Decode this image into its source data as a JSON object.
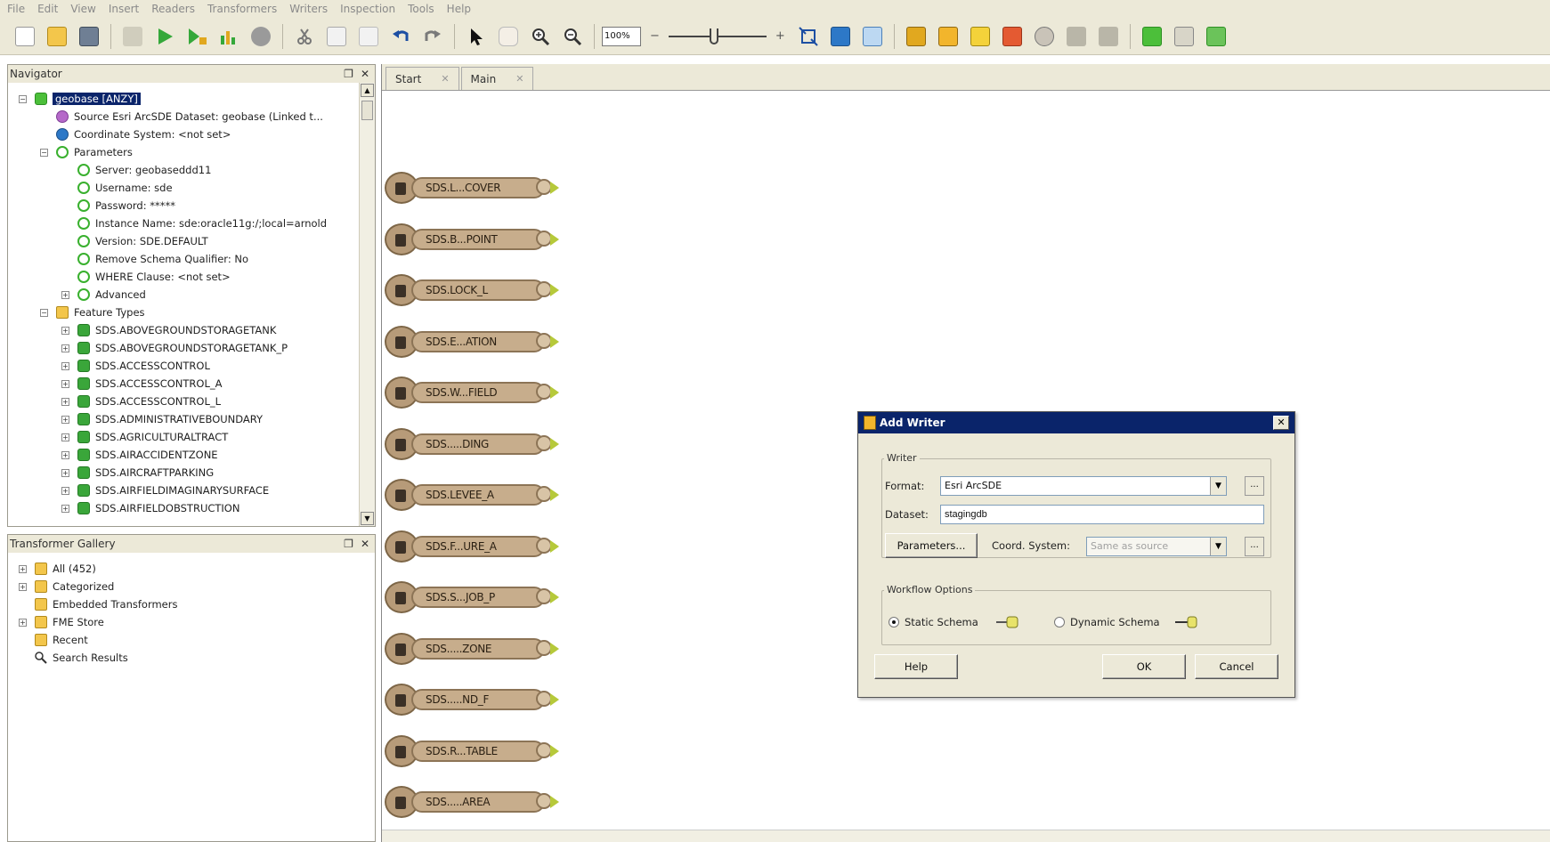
{
  "menu": [
    "File",
    "Edit",
    "View",
    "Insert",
    "Readers",
    "Transformers",
    "Writers",
    "Inspection",
    "Tools",
    "Help"
  ],
  "toolbar": {
    "zoom_value": "100%",
    "zoom_minus": "−",
    "zoom_plus": "+"
  },
  "navigator": {
    "title": "Navigator",
    "float_glyph": "❐",
    "close_glyph": "✕",
    "items": [
      {
        "text": "geobase [ANZY]",
        "level": 0,
        "icon": "database-icon",
        "expander": "−",
        "selected": true
      },
      {
        "text": "Source Esri ArcSDE Dataset: geobase (Linked t...",
        "level": 1,
        "icon": "source-icon"
      },
      {
        "text": "Coordinate System: <not set>",
        "level": 1,
        "icon": "globe-icon"
      },
      {
        "text": "Parameters",
        "level": 1,
        "icon": "parameters-icon",
        "expander": "−"
      },
      {
        "text": "Server: geobaseddd11",
        "level": 2,
        "icon": "parameter-icon"
      },
      {
        "text": "Username: sde",
        "level": 2,
        "icon": "parameter-icon"
      },
      {
        "text": "Password: *****",
        "level": 2,
        "icon": "parameter-icon"
      },
      {
        "text": "Instance Name: sde:oracle11g:/;local=arnold",
        "level": 2,
        "icon": "parameter-icon"
      },
      {
        "text": "Version: SDE.DEFAULT",
        "level": 2,
        "icon": "parameter-icon"
      },
      {
        "text": "Remove Schema Qualifier: No",
        "level": 2,
        "icon": "parameter-icon"
      },
      {
        "text": "WHERE Clause: <not set>",
        "level": 2,
        "icon": "parameter-icon"
      },
      {
        "text": "Advanced",
        "level": 2,
        "icon": "parameter-icon",
        "expander": "+"
      },
      {
        "text": "Feature Types",
        "level": 1,
        "icon": "feature-types-icon",
        "expander": "−"
      },
      {
        "text": "SDS.ABOVEGROUNDSTORAGETANK",
        "level": 2,
        "icon": "feature-type-icon",
        "expander": "+"
      },
      {
        "text": "SDS.ABOVEGROUNDSTORAGETANK_P",
        "level": 2,
        "icon": "feature-type-icon",
        "expander": "+"
      },
      {
        "text": "SDS.ACCESSCONTROL",
        "level": 2,
        "icon": "feature-type-icon",
        "expander": "+"
      },
      {
        "text": "SDS.ACCESSCONTROL_A",
        "level": 2,
        "icon": "feature-type-icon",
        "expander": "+"
      },
      {
        "text": "SDS.ACCESSCONTROL_L",
        "level": 2,
        "icon": "feature-type-icon",
        "expander": "+"
      },
      {
        "text": "SDS.ADMINISTRATIVEBOUNDARY",
        "level": 2,
        "icon": "feature-type-icon",
        "expander": "+"
      },
      {
        "text": "SDS.AGRICULTURALTRACT",
        "level": 2,
        "icon": "feature-type-icon",
        "expander": "+"
      },
      {
        "text": "SDS.AIRACCIDENTZONE",
        "level": 2,
        "icon": "feature-type-icon",
        "expander": "+"
      },
      {
        "text": "SDS.AIRCRAFTPARKING",
        "level": 2,
        "icon": "feature-type-icon",
        "expander": "+"
      },
      {
        "text": "SDS.AIRFIELDIMAGINARYSURFACE",
        "level": 2,
        "icon": "feature-type-icon",
        "expander": "+"
      },
      {
        "text": "SDS.AIRFIELDOBSTRUCTION",
        "level": 2,
        "icon": "feature-type-icon",
        "expander": "+"
      }
    ]
  },
  "gallery": {
    "title": "Transformer Gallery",
    "float_glyph": "❐",
    "close_glyph": "✕",
    "items": [
      {
        "text": "All (452)",
        "icon": "folder-icon",
        "expander": "+"
      },
      {
        "text": "Categorized",
        "icon": "folder-icon",
        "expander": "+"
      },
      {
        "text": "Embedded Transformers",
        "icon": "folder-icon"
      },
      {
        "text": "FME Store",
        "icon": "folder-icon",
        "expander": "+"
      },
      {
        "text": "Recent",
        "icon": "folder-icon"
      },
      {
        "text": "Search Results",
        "icon": "search-icon"
      }
    ]
  },
  "canvas": {
    "tabs": [
      {
        "label": "Start",
        "close": "✕"
      },
      {
        "label": "Main",
        "close": "✕"
      }
    ],
    "nodes": [
      "SDS.L...COVER",
      "SDS.B...POINT",
      "SDS.LOCK_L",
      "SDS.E...ATION",
      "SDS.W...FIELD",
      "SDS.....DING",
      "SDS.LEVEE_A",
      "SDS.F...URE_A",
      "SDS.S...JOB_P",
      "SDS.....ZONE",
      "SDS.....ND_F",
      "SDS.R...TABLE",
      "SDS.....AREA"
    ]
  },
  "dialog": {
    "title": "Add Writer",
    "close": "✕",
    "writer_group": "Writer",
    "format_label": "Format:",
    "format_value": "Esri ArcSDE",
    "dataset_label": "Dataset:",
    "dataset_value": "stagingdb",
    "parameters_button": "Parameters...",
    "coord_label": "Coord. System:",
    "coord_placeholder": "Same as source",
    "ellipsis": "...",
    "workflow_group": "Workflow Options",
    "static_schema": "Static Schema",
    "dynamic_schema": "Dynamic Schema",
    "help_button": "Help",
    "ok_button": "OK",
    "cancel_button": "Cancel"
  },
  "colors": {
    "title_blue": "#0a246a",
    "chrome": "#ece9d8",
    "node_fill": "#c7ad8c",
    "param_green": "#39b02e"
  }
}
